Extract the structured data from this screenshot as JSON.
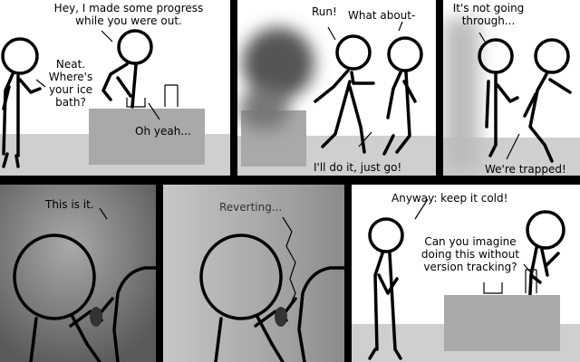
{
  "panels": [
    {
      "lines": [
        {
          "text": "Hey, I made some progress\nwhile you were out."
        },
        {
          "text": "Neat.\nWhere's\nyour ice\nbath?"
        },
        {
          "text": "Oh yeah..."
        }
      ]
    },
    {
      "lines": [
        {
          "text": "Run!"
        },
        {
          "text": "What about-"
        },
        {
          "text": "I'll do it, just go!"
        }
      ]
    },
    {
      "lines": [
        {
          "text": "It's not going\nthrough..."
        },
        {
          "text": "We're trapped!"
        }
      ]
    },
    {
      "lines": [
        {
          "text": "This is it."
        }
      ]
    },
    {
      "lines": [
        {
          "text": "Reverting..."
        }
      ]
    },
    {
      "lines": [
        {
          "text": "Anyway: keep it cold!"
        },
        {
          "text": "Can you imagine\ndoing this without\nversion tracking?"
        }
      ]
    }
  ]
}
